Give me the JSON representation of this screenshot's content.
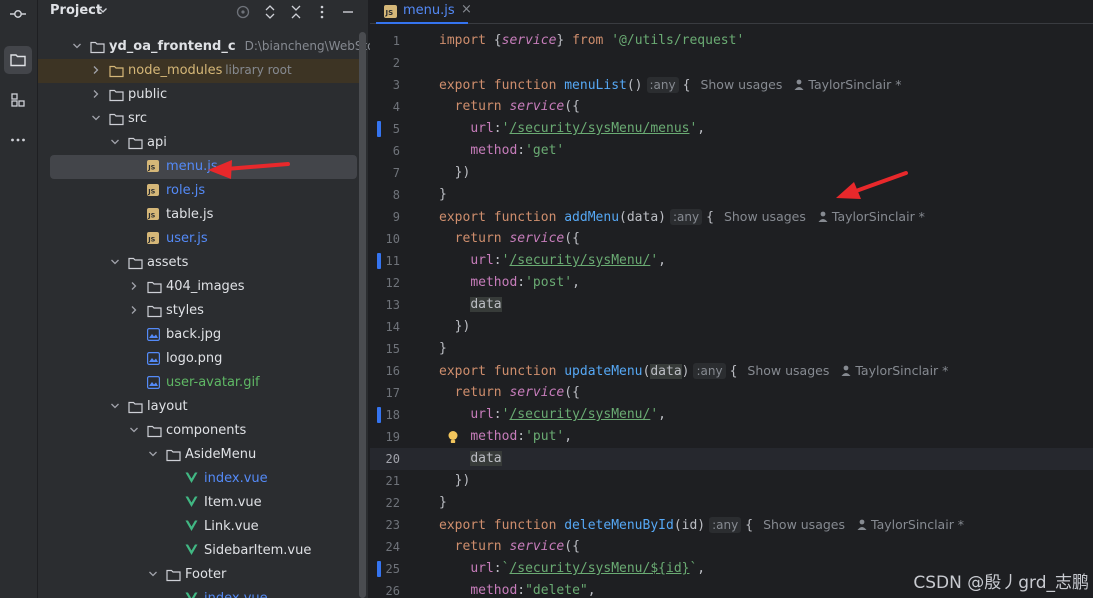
{
  "panel": {
    "title": "Project"
  },
  "tree": [
    {
      "label": "yd_oa_frontend_c",
      "sub": "D:\\biancheng\\WebStormProj",
      "kind": "root",
      "depth": 0,
      "arrow": "down",
      "icon": "folder"
    },
    {
      "label": "node_modules",
      "sub": "library root",
      "kind": "excluded",
      "depth": 1,
      "arrow": "right",
      "icon": "folder-excluded"
    },
    {
      "label": "public",
      "depth": 1,
      "arrow": "right",
      "icon": "folder"
    },
    {
      "label": "src",
      "depth": 1,
      "arrow": "down",
      "icon": "folder"
    },
    {
      "label": "api",
      "depth": 2,
      "arrow": "down",
      "icon": "folder"
    },
    {
      "label": "menu.js",
      "depth": 3,
      "icon": "js",
      "color": "blue",
      "selected": true
    },
    {
      "label": "role.js",
      "depth": 3,
      "icon": "js",
      "color": "blue"
    },
    {
      "label": "table.js",
      "depth": 3,
      "icon": "js"
    },
    {
      "label": "user.js",
      "depth": 3,
      "icon": "js",
      "color": "blue"
    },
    {
      "label": "assets",
      "depth": 2,
      "arrow": "down",
      "icon": "folder"
    },
    {
      "label": "404_images",
      "depth": 3,
      "arrow": "right",
      "icon": "folder"
    },
    {
      "label": "styles",
      "depth": 3,
      "arrow": "right",
      "icon": "folder"
    },
    {
      "label": "back.jpg",
      "depth": 3,
      "icon": "image"
    },
    {
      "label": "logo.png",
      "depth": 3,
      "icon": "image"
    },
    {
      "label": "user-avatar.gif",
      "depth": 3,
      "icon": "image",
      "color": "green"
    },
    {
      "label": "layout",
      "depth": 2,
      "arrow": "down",
      "icon": "folder"
    },
    {
      "label": "components",
      "depth": 3,
      "arrow": "down",
      "icon": "folder"
    },
    {
      "label": "AsideMenu",
      "depth": 4,
      "arrow": "down",
      "icon": "folder"
    },
    {
      "label": "index.vue",
      "depth": 5,
      "icon": "vue",
      "color": "blue"
    },
    {
      "label": "Item.vue",
      "depth": 5,
      "icon": "vue"
    },
    {
      "label": "Link.vue",
      "depth": 5,
      "icon": "vue"
    },
    {
      "label": "SidebarItem.vue",
      "depth": 5,
      "icon": "vue"
    },
    {
      "label": "Footer",
      "depth": 4,
      "arrow": "down",
      "icon": "folder"
    },
    {
      "label": "index.vue",
      "depth": 5,
      "icon": "vue",
      "color": "blue"
    }
  ],
  "tab": {
    "label": "menu.js",
    "close": "×"
  },
  "editor": {
    "hint_type": "any",
    "show_usages": "Show usages",
    "author": "TaylorSinclair *",
    "current_line": 20,
    "changed_lines": [
      5,
      11,
      18,
      25
    ],
    "bulb_line": 19
  },
  "lines": [
    {
      "n": 1,
      "t": [
        [
          "kw",
          "import "
        ],
        [
          "pl",
          "{"
        ],
        [
          "prm",
          "service"
        ],
        [
          "pl",
          "} "
        ],
        [
          "kw",
          "from "
        ],
        [
          "str",
          "'@/utils/request'"
        ]
      ]
    },
    {
      "n": 2,
      "t": []
    },
    {
      "n": 3,
      "t": [
        [
          "kw",
          "export function "
        ],
        [
          "fn",
          "menuList"
        ],
        [
          "pl",
          "()"
        ]
      ],
      "hint": true,
      "tail": "{",
      "usage": true
    },
    {
      "n": 4,
      "t": [
        [
          "pl",
          "  "
        ],
        [
          "kw",
          "return "
        ],
        [
          "prm",
          "service"
        ],
        [
          "pl",
          "({"
        ]
      ]
    },
    {
      "n": 5,
      "t": [
        [
          "pl",
          "    "
        ],
        [
          "prop",
          "url"
        ],
        [
          "pl",
          ":"
        ],
        [
          "str",
          "'"
        ],
        [
          "ustr",
          "/security/sysMenu/menus"
        ],
        [
          "str",
          "'"
        ],
        [
          "pl",
          ","
        ]
      ]
    },
    {
      "n": 6,
      "t": [
        [
          "pl",
          "    "
        ],
        [
          "prop",
          "method"
        ],
        [
          "pl",
          ":"
        ],
        [
          "str",
          "'get'"
        ]
      ]
    },
    {
      "n": 7,
      "t": [
        [
          "pl",
          "  })"
        ]
      ]
    },
    {
      "n": 8,
      "t": [
        [
          "pl",
          "}"
        ]
      ]
    },
    {
      "n": 9,
      "t": [
        [
          "kw",
          "export function "
        ],
        [
          "fn",
          "addMenu"
        ],
        [
          "pl",
          "(data)"
        ]
      ],
      "hint": true,
      "tail": "{",
      "usage": true
    },
    {
      "n": 10,
      "t": [
        [
          "pl",
          "  "
        ],
        [
          "kw",
          "return "
        ],
        [
          "prm",
          "service"
        ],
        [
          "pl",
          "({"
        ]
      ]
    },
    {
      "n": 11,
      "t": [
        [
          "pl",
          "    "
        ],
        [
          "prop",
          "url"
        ],
        [
          "pl",
          ":"
        ],
        [
          "str",
          "'"
        ],
        [
          "ustr",
          "/security/sysMenu/"
        ],
        [
          "str",
          "'"
        ],
        [
          "pl",
          ","
        ]
      ]
    },
    {
      "n": 12,
      "t": [
        [
          "pl",
          "    "
        ],
        [
          "prop",
          "method"
        ],
        [
          "pl",
          ":"
        ],
        [
          "str",
          "'post'"
        ],
        [
          "pl",
          ","
        ]
      ]
    },
    {
      "n": 13,
      "t": [
        [
          "pl",
          "    "
        ],
        [
          "var",
          "data"
        ]
      ]
    },
    {
      "n": 14,
      "t": [
        [
          "pl",
          "  })"
        ]
      ]
    },
    {
      "n": 15,
      "t": [
        [
          "pl",
          "}"
        ]
      ]
    },
    {
      "n": 16,
      "t": [
        [
          "kw",
          "export function "
        ],
        [
          "fn",
          "updateMenu"
        ],
        [
          "pl",
          "("
        ],
        [
          "var",
          "data"
        ],
        [
          "pl",
          ")"
        ]
      ],
      "hint": true,
      "tail": "{",
      "usage": true
    },
    {
      "n": 17,
      "t": [
        [
          "pl",
          "  "
        ],
        [
          "kw",
          "return "
        ],
        [
          "prm",
          "service"
        ],
        [
          "pl",
          "({"
        ]
      ]
    },
    {
      "n": 18,
      "t": [
        [
          "pl",
          "    "
        ],
        [
          "prop",
          "url"
        ],
        [
          "pl",
          ":"
        ],
        [
          "str",
          "'"
        ],
        [
          "ustr",
          "/security/sysMenu/"
        ],
        [
          "str",
          "'"
        ],
        [
          "pl",
          ","
        ]
      ]
    },
    {
      "n": 19,
      "t": [
        [
          "pl",
          "    "
        ],
        [
          "prop",
          "method"
        ],
        [
          "pl",
          ":"
        ],
        [
          "str",
          "'put'"
        ],
        [
          "pl",
          ","
        ]
      ]
    },
    {
      "n": 20,
      "t": [
        [
          "pl",
          "    "
        ],
        [
          "var",
          "data"
        ]
      ]
    },
    {
      "n": 21,
      "t": [
        [
          "pl",
          "  })"
        ]
      ]
    },
    {
      "n": 22,
      "t": [
        [
          "pl",
          "}"
        ]
      ]
    },
    {
      "n": 23,
      "t": [
        [
          "kw",
          "export function "
        ],
        [
          "fn",
          "deleteMenuById"
        ],
        [
          "pl",
          "(id)"
        ]
      ],
      "hint": true,
      "tail": "{",
      "usage": true
    },
    {
      "n": 24,
      "t": [
        [
          "pl",
          "  "
        ],
        [
          "kw",
          "return "
        ],
        [
          "prm",
          "service"
        ],
        [
          "pl",
          "({"
        ]
      ]
    },
    {
      "n": 25,
      "t": [
        [
          "pl",
          "    "
        ],
        [
          "prop",
          "url"
        ],
        [
          "pl",
          ":"
        ],
        [
          "str",
          "`"
        ],
        [
          "ustr",
          "/security/sysMenu/${id}"
        ],
        [
          "str",
          "`"
        ],
        [
          "pl",
          ","
        ]
      ]
    },
    {
      "n": 26,
      "t": [
        [
          "pl",
          "    "
        ],
        [
          "prop",
          "method"
        ],
        [
          "pl",
          ":"
        ],
        [
          "str",
          "\"delete\""
        ],
        [
          "pl",
          ","
        ]
      ]
    }
  ],
  "watermark": "CSDN @殷丿grd_志鹏",
  "colors": {
    "accent": "#3574f0",
    "arrow": "#e8282b",
    "background": "#1e1f22",
    "panel": "#2b2d30"
  }
}
